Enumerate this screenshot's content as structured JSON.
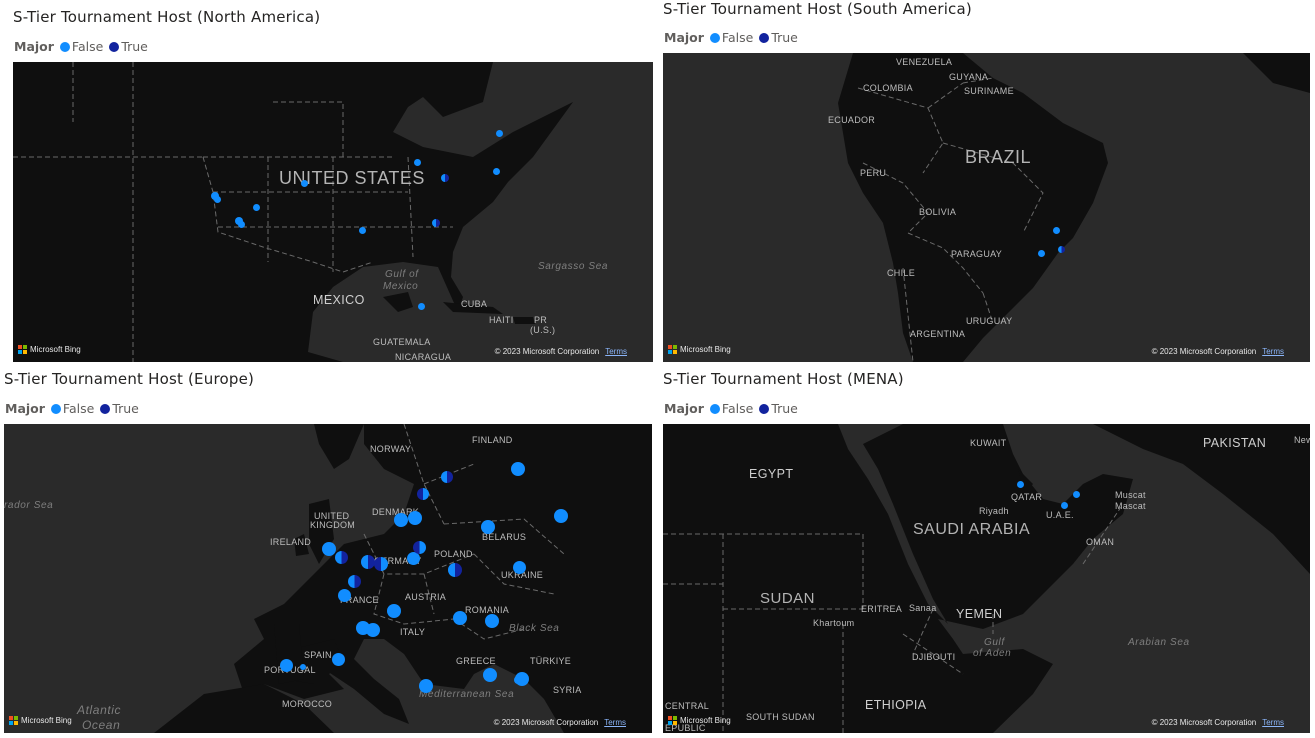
{
  "colors": {
    "false": "#118dff",
    "true": "#12239e",
    "map_bg": "#2a2a2a"
  },
  "legend": {
    "title": "Major",
    "false_label": "False",
    "true_label": "True"
  },
  "attribution": {
    "bing": "Microsoft Bing",
    "copyright": "© 2023 Microsoft Corporation",
    "terms": "Terms"
  },
  "panels": {
    "na": {
      "title": "S-Tier Tournament Host (North America)",
      "labels": [
        "UNITED STATES",
        "MEXICO",
        "Gulf of",
        "Mexico",
        "Sargasso Sea",
        "CUBA",
        "HAITI",
        "PR",
        "(U.S.)",
        "GUATEMALA",
        "NICARAGUA"
      ],
      "pins": [
        {
          "major": false
        },
        {
          "major": false
        },
        {
          "major": false
        },
        {
          "major": false
        },
        {
          "major": false
        },
        {
          "major": false
        },
        {
          "major": false
        },
        {
          "major": false
        },
        {
          "major": false
        },
        {
          "major": false
        },
        {
          "major": true
        },
        {
          "major": true
        },
        {
          "major": false
        }
      ]
    },
    "sa": {
      "title": "S-Tier Tournament Host (South America)",
      "labels": [
        "VENEZUELA",
        "GUYANA",
        "SURINAME",
        "COLOMBIA",
        "ECUADOR",
        "BRAZIL",
        "PERU",
        "BOLIVIA",
        "PARAGUAY",
        "CHILE",
        "URUGUAY",
        "ARGENTINA"
      ],
      "pins": [
        {
          "major": false
        },
        {
          "major": false
        },
        {
          "major": true
        }
      ]
    },
    "eu": {
      "title": "S-Tier Tournament Host (Europe)",
      "labels": [
        "FINLAND",
        "NORWAY",
        "DENMARK",
        "UNITED",
        "KINGDOM",
        "IRELAND",
        "BELARUS",
        "POLAND",
        "GERMANY",
        "UKRAINE",
        "FRANCE",
        "AUSTRIA",
        "ROMANIA",
        "ITALY",
        "Black Sea",
        "SPAIN",
        "PORTUGAL",
        "GREECE",
        "TÜRKIYE",
        "SYRIA",
        "Mediterranean Sea",
        "MOROCCO",
        "Atlantic",
        "Ocean",
        "rador Sea"
      ],
      "pins": [
        {
          "major": false
        },
        {
          "major": true
        },
        {
          "major": true
        },
        {
          "major": false
        },
        {
          "major": false
        },
        {
          "major": false
        },
        {
          "major": false
        },
        {
          "major": false
        },
        {
          "major": true
        },
        {
          "major": true
        },
        {
          "major": true
        },
        {
          "major": false
        },
        {
          "major": true
        },
        {
          "major": true
        },
        {
          "major": true
        },
        {
          "major": false
        },
        {
          "major": false
        },
        {
          "major": false
        },
        {
          "major": false
        },
        {
          "major": false
        },
        {
          "major": false
        },
        {
          "major": false
        },
        {
          "major": false
        },
        {
          "major": false
        },
        {
          "major": false
        },
        {
          "major": false
        },
        {
          "major": false
        },
        {
          "major": false
        },
        {
          "major": false
        }
      ]
    },
    "mena": {
      "title": "S-Tier Tournament Host (MENA)",
      "labels": [
        "KUWAIT",
        "PAKISTAN",
        "New D",
        "EGYPT",
        "QATAR",
        "Riyadh",
        "U.A.E.",
        "Muscat",
        "Mascat",
        "SAUDI ARABIA",
        "OMAN",
        "SUDAN",
        "ERITREA",
        "Sanaa",
        "Khartoum",
        "YEMEN",
        "Gulf",
        "of Aden",
        "DJIBOUTI",
        "Arabian Sea",
        "ETHIOPIA",
        "SOUTH SUDAN",
        "CENTRAL",
        "EPUBLIC"
      ],
      "pins": [
        {
          "major": false
        },
        {
          "major": false
        },
        {
          "major": false
        }
      ]
    }
  }
}
